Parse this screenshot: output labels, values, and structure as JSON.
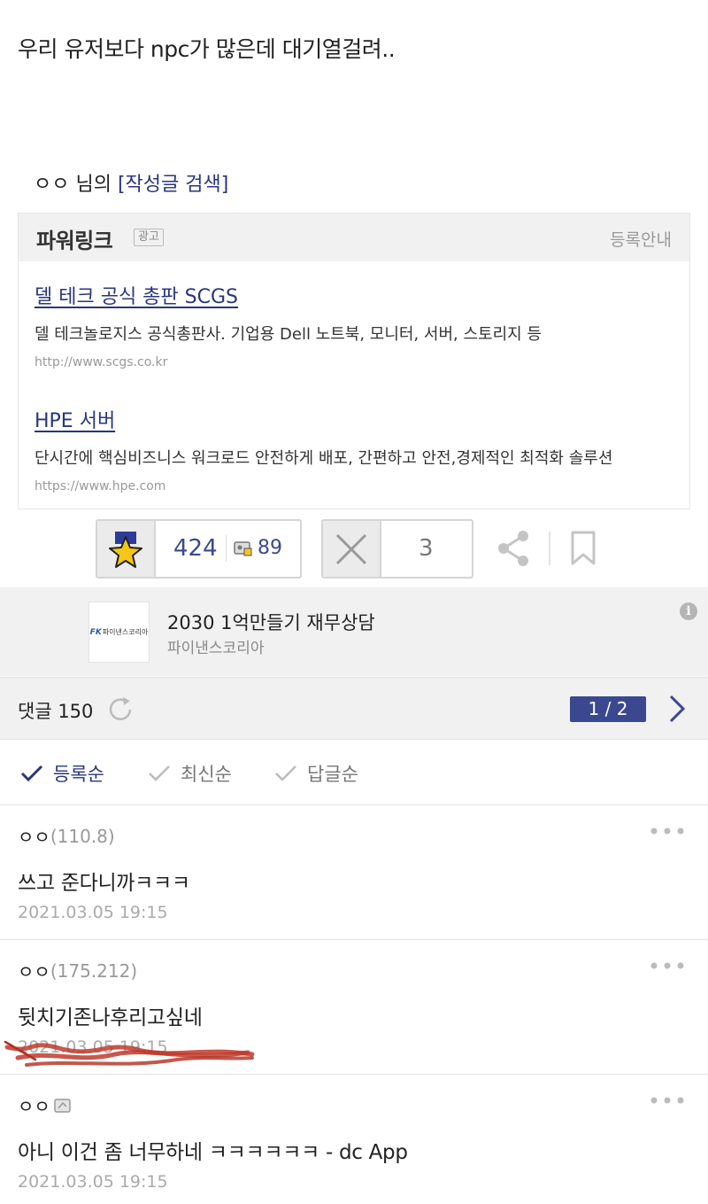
{
  "post": {
    "body_text": "우리 유저보다 npc가 많은데 대기열걸려..",
    "author_prefix": "ㅇㅇ 님의 ",
    "author_search_link": "[작성글 검색]"
  },
  "powerlink": {
    "title": "파워링크",
    "ad_badge": "광고",
    "register_link": "등록안내",
    "ads": [
      {
        "title": "델 테크 공식 총판 SCGS",
        "description": "델 테크놀로지스 공식총판사. 기업용 Dell 노트북, 모니터, 서버, 스토리지 등",
        "url": "http://www.scgs.co.kr"
      },
      {
        "title": "HPE 서버",
        "description": "단시간에 핵심비즈니스 워크로드 안전하게 배포, 간편하고 안전,경제적인 최적화 솔루션",
        "url": "https://www.hpe.com"
      }
    ]
  },
  "votes": {
    "up_count": "424",
    "fixed_up_count": "89",
    "down_count": "3"
  },
  "promo": {
    "logo_mark": "FK",
    "logo_text": "파이낸스코리아",
    "title": "2030 1억만들기 재무상담",
    "subtitle": "파이낸스코리아",
    "info_symbol": "i"
  },
  "comments_bar": {
    "label": "댓글 150",
    "page_indicator": "1 / 2"
  },
  "sort_tabs": [
    {
      "label": "등록순",
      "active": true
    },
    {
      "label": "최신순",
      "active": false
    },
    {
      "label": "답글순",
      "active": false
    }
  ],
  "comments": [
    {
      "nickname": "ㅇㅇ",
      "ip": "(110.8)",
      "text": "쓰고 준다니까ㅋㅋㅋ",
      "date": "2021.03.05 19:15"
    },
    {
      "nickname": "ㅇㅇ",
      "ip": "(175.212)",
      "text": "뒷치기존나후리고싶네",
      "date": "2021.03.05 19:15"
    },
    {
      "nickname": "ㅇㅇ",
      "ip": "",
      "text": "아니 이건 좀 너무하네 ㅋㅋㅋㅋㅋㅋ - dc App",
      "date": "2021.03.05 19:15"
    }
  ],
  "colors": {
    "accent": "#3b4890",
    "link": "#29367c",
    "muted": "#999999",
    "panel_bg": "#f1f1f1",
    "scribble": "#c0392b"
  },
  "icons": [
    "star-vote-icon",
    "fixed-user-icon",
    "x-vote-icon",
    "share-icon",
    "bookmark-icon",
    "info-icon",
    "refresh-icon",
    "chevron-right-icon",
    "checkmark-icon",
    "more-dots-icon",
    "member-badge-icon"
  ]
}
